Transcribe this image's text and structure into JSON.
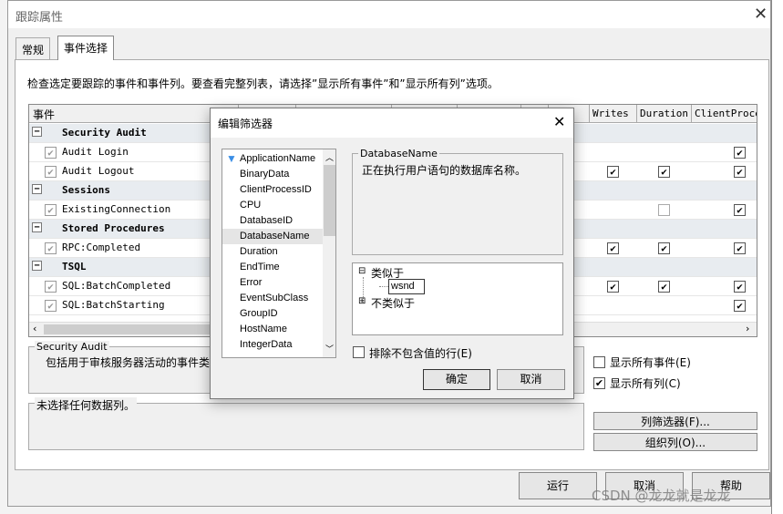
{
  "window": {
    "title": "跟踪属性",
    "close": "✕"
  },
  "tabs": [
    {
      "label": "常规"
    },
    {
      "label": "事件选择"
    }
  ],
  "description": "检查选定要跟踪的事件和事件列。要查看完整列表，请选择”显示所有事件”和”显示所有列”选项。",
  "grid": {
    "headers": [
      "事件",
      "",
      "",
      "",
      "",
      "",
      "s",
      "Writes",
      "Duration",
      "ClientProce"
    ],
    "rows": [
      {
        "type": "category",
        "name": "Security Audit",
        "expander": "−"
      },
      {
        "type": "event",
        "name": "Audit Login",
        "writes": null,
        "duration": null,
        "client": true
      },
      {
        "type": "event",
        "name": "Audit Logout",
        "writes": true,
        "duration": true,
        "client": true
      },
      {
        "type": "category",
        "name": "Sessions",
        "expander": "−"
      },
      {
        "type": "event",
        "name": "ExistingConnection",
        "writes": null,
        "duration": false,
        "client": true
      },
      {
        "type": "category",
        "name": "Stored Procedures",
        "expander": "−"
      },
      {
        "type": "event",
        "name": "RPC:Completed",
        "writes": true,
        "duration": true,
        "client": true
      },
      {
        "type": "category",
        "name": "TSQL",
        "expander": "−"
      },
      {
        "type": "event",
        "name": "SQL:BatchCompleted",
        "writes": true,
        "duration": true,
        "client": true
      },
      {
        "type": "event",
        "name": "SQL:BatchStarting",
        "writes": null,
        "duration": null,
        "client": true
      }
    ]
  },
  "event_group": {
    "label": "Security Audit",
    "text": "包括用于审核服务器活动的事件类"
  },
  "column_group": {
    "label": "未选择任何数据列。"
  },
  "options": {
    "show_all_events": {
      "label": "显示所有事件(E)",
      "checked": false
    },
    "show_all_columns": {
      "label": "显示所有列(C)",
      "checked": true
    }
  },
  "side_buttons": {
    "column_filter": "列筛选器(F)...",
    "organize_columns": "组织列(O)..."
  },
  "footer": {
    "run": "运行",
    "cancel": "取消",
    "help": "帮助"
  },
  "watermark": "CSDN @龙龙就是龙龙",
  "dialog": {
    "title": "编辑筛选器",
    "close": "✕",
    "columns": [
      "ApplicationName",
      "BinaryData",
      "ClientProcessID",
      "CPU",
      "DatabaseID",
      "DatabaseName",
      "Duration",
      "EndTime",
      "Error",
      "EventSubClass",
      "GroupID",
      "HostName",
      "IntegerData"
    ],
    "selected_column": "DatabaseName",
    "filtered_column": "ApplicationName",
    "info_label": "DatabaseName",
    "info_text": "正在执行用户语句的数据库名称。",
    "tree": {
      "like": "类似于",
      "like_value": "wsnd",
      "not_like": "不类似于"
    },
    "exclude_empty": {
      "label": "排除不包含值的行(E)",
      "checked": false
    },
    "ok": "确定",
    "cancel": "取消"
  }
}
